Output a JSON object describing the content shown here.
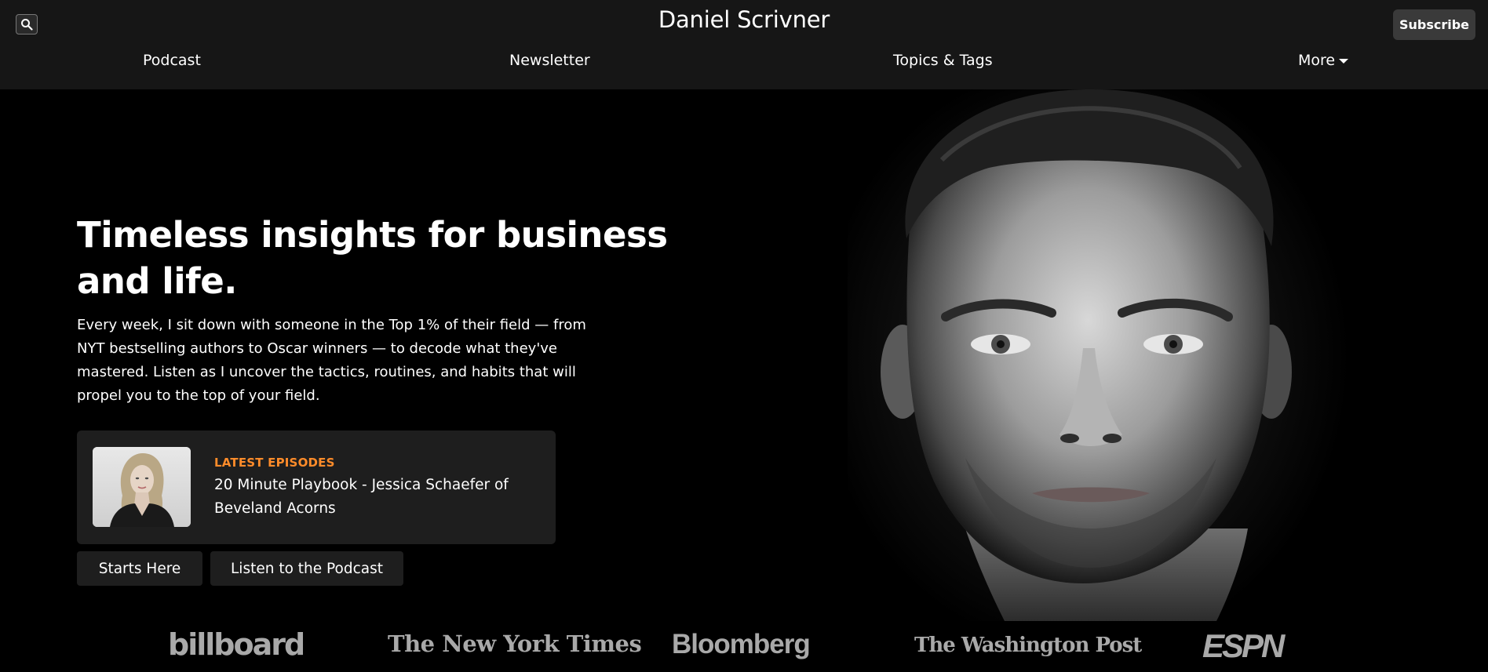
{
  "header": {
    "site_title": "Daniel Scrivner",
    "subscribe_label": "Subscribe",
    "search_icon": "search-icon"
  },
  "nav": {
    "items": [
      {
        "label": "Podcast"
      },
      {
        "label": "Newsletter"
      },
      {
        "label": "Topics & Tags"
      },
      {
        "label": "More"
      }
    ]
  },
  "hero": {
    "title": "Timeless insights for business and life.",
    "description": "Every week, I sit down with someone in the Top 1% of their field — from NYT bestselling authors to Oscar winners — to decode what they've mastered. Listen as I uncover the tactics, routines, and habits that will propel you to the top of your field."
  },
  "latest_episode": {
    "tag": "LATEST EPISODES",
    "title": "20 Minute Playbook - Jessica Schaefer of Beveland Acorns"
  },
  "buttons": {
    "starts_here": "Starts Here",
    "listen": "Listen to the Podcast"
  },
  "press": {
    "logos": [
      "billboard",
      "The New York Times",
      "Bloomberg",
      "The Washington Post",
      "ESPN"
    ]
  },
  "colors": {
    "background": "#000000",
    "header_bg": "#161616",
    "card_bg": "#1e1e1e",
    "accent": "#ff8c2a",
    "logo_gray": "#a9a9a9"
  }
}
